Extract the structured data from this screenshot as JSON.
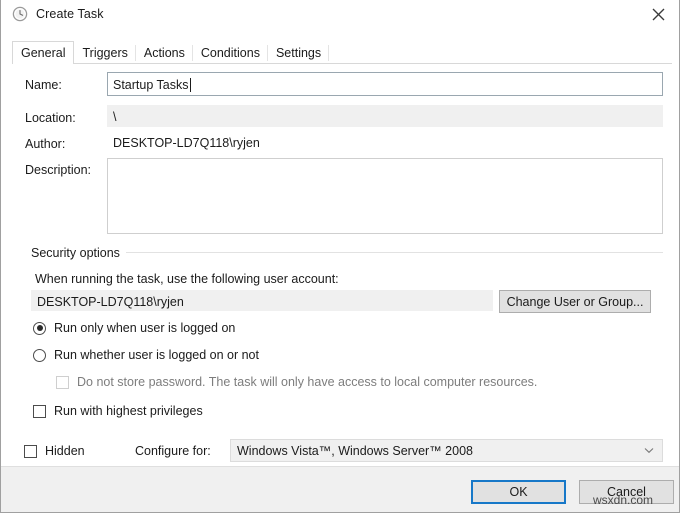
{
  "window": {
    "title": "Create Task",
    "icon": "clock-icon",
    "close_label": "✕"
  },
  "tabs": [
    {
      "label": "General",
      "active": true
    },
    {
      "label": "Triggers",
      "active": false
    },
    {
      "label": "Actions",
      "active": false
    },
    {
      "label": "Conditions",
      "active": false
    },
    {
      "label": "Settings",
      "active": false
    }
  ],
  "general": {
    "name_label": "Name:",
    "name_value": "Startup Tasks",
    "location_label": "Location:",
    "location_value": "\\",
    "author_label": "Author:",
    "author_value": "DESKTOP-LD7Q118\\ryjen",
    "description_label": "Description:",
    "description_value": ""
  },
  "security": {
    "group_label": "Security options",
    "account_prompt": "When running the task, use the following user account:",
    "account_value": "DESKTOP-LD7Q118\\ryjen",
    "change_user_button": "Change User or Group...",
    "radio_logged_on": "Run only when user is logged on",
    "radio_logged_on_checked": true,
    "radio_whether_logged": "Run whether user is logged on or not",
    "radio_whether_logged_checked": false,
    "checkbox_no_password": "Do not store password.  The task will only have access to local computer resources.",
    "checkbox_no_password_checked": false,
    "checkbox_no_password_disabled": true,
    "checkbox_highest_privileges": "Run with highest privileges",
    "checkbox_highest_privileges_checked": false
  },
  "bottom": {
    "hidden_label": "Hidden",
    "hidden_checked": false,
    "configure_for_label": "Configure for:",
    "configure_for_value": "Windows Vista™, Windows Server™ 2008",
    "configure_for_arrow": "chevron-down-icon"
  },
  "footer": {
    "ok_label": "OK",
    "cancel_label": "Cancel",
    "watermark": "wsxdn.com"
  },
  "colors": {
    "accent": "#1778c8",
    "window_bg": "#ffffff",
    "footer_bg": "#f0f0f0",
    "readonly_field_bg": "#f0f0f0",
    "text": "#1b1b1b"
  }
}
